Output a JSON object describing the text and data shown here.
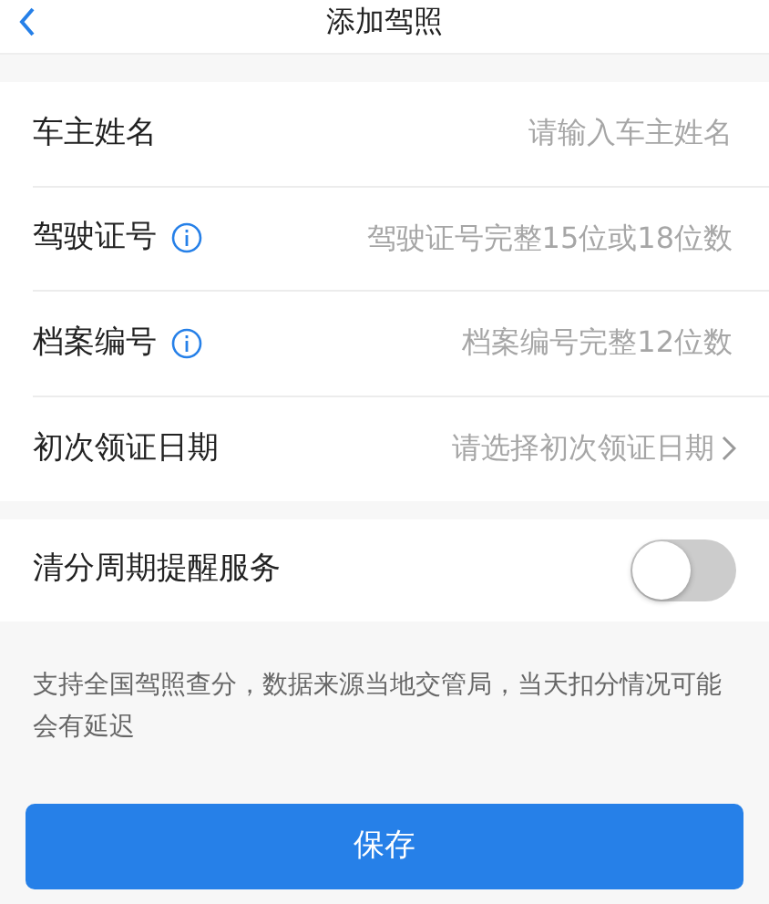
{
  "header": {
    "title": "添加驾照"
  },
  "fields": [
    {
      "label": "车主姓名",
      "placeholder": "请输入车主姓名",
      "kind": "input",
      "info": false
    },
    {
      "label": "驾驶证号",
      "placeholder": "驾驶证号完整15位或18位数",
      "kind": "input",
      "info": true
    },
    {
      "label": "档案编号",
      "placeholder": "档案编号完整12位数",
      "kind": "input",
      "info": true
    },
    {
      "label": "初次领证日期",
      "placeholder": "请选择初次领证日期",
      "kind": "picker",
      "info": false
    }
  ],
  "reminder": {
    "label": "清分周期提醒服务",
    "on": false
  },
  "note": "支持全国驾照查分，数据来源当地交管局，当天扣分情况可能会有延迟",
  "save_button": "保存"
}
